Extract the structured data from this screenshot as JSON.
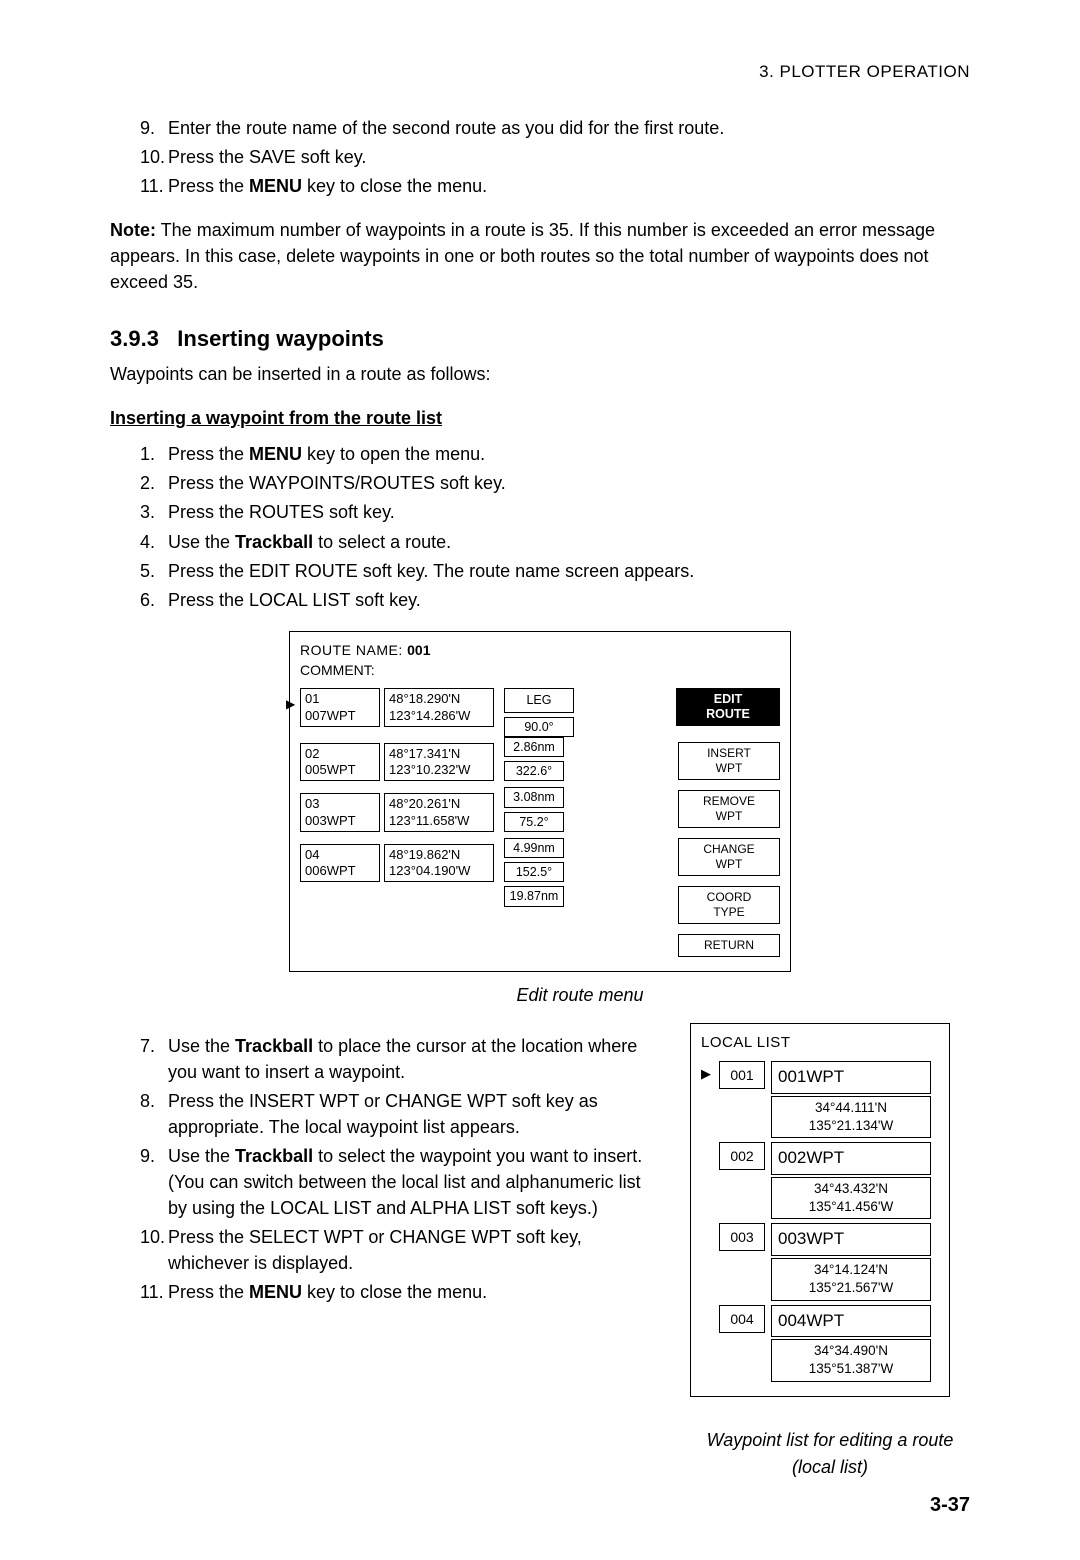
{
  "header": "3.  PLOTTER  OPERATION",
  "steps_top": [
    {
      "n": "9.",
      "t_pre": "Enter the route name of the second route as you did for the first route."
    },
    {
      "n": "10.",
      "t_pre": "Press the SAVE soft key."
    },
    {
      "n": "11.",
      "t_pre": "Press the ",
      "bold": "MENU",
      "t_post": " key to close the menu."
    }
  ],
  "note_label": "Note:",
  "note_text": " The maximum number of waypoints in a route is 35. If this number is exceeded an error message appears. In this case, delete waypoints in one or both routes so the total number of waypoints does not exceed 35.",
  "sec_num": "3.9.3",
  "sec_title": "Inserting waypoints",
  "sec_intro": "Waypoints can be inserted in a route as follows:",
  "sub1": "Inserting a waypoint from the route list",
  "steps1": [
    {
      "n": "1.",
      "pre": "Press the ",
      "b": "MENU",
      "post": " key to open the menu."
    },
    {
      "n": "2.",
      "pre": "Press the WAYPOINTS/ROUTES soft key."
    },
    {
      "n": "3.",
      "pre": "Press the ROUTES soft key."
    },
    {
      "n": "4.",
      "pre": "Use the ",
      "b": "Trackball",
      "post": " to select a route."
    },
    {
      "n": "5.",
      "pre": "Press the EDIT ROUTE soft key. The route name screen appears."
    },
    {
      "n": "6.",
      "pre": "Press the LOCAL LIST soft key."
    }
  ],
  "fig1": {
    "route_name_label": "ROUTE NAME: ",
    "route_name_value": "001",
    "comment_label": "COMMENT:",
    "leg_label": "LEG",
    "header_sk": "EDIT\nROUTE",
    "soft_keys": [
      "INSERT\nWPT",
      "REMOVE\nWPT",
      "CHANGE\nWPT",
      "COORD\nTYPE",
      "RETURN"
    ],
    "rows": [
      {
        "idx": "01",
        "name": "007WPT",
        "lat": "48°18.290'N",
        "lon": "123°14.286'W",
        "brg": "90.0°",
        "dist": "2.86nm"
      },
      {
        "idx": "02",
        "name": "005WPT",
        "lat": "48°17.341'N",
        "lon": "123°10.232'W",
        "brg": "322.6°",
        "dist": "3.08nm"
      },
      {
        "idx": "03",
        "name": "003WPT",
        "lat": "48°20.261'N",
        "lon": "123°11.658'W",
        "brg": "75.2°",
        "dist": "4.99nm"
      },
      {
        "idx": "04",
        "name": "006WPT",
        "lat": "48°19.862'N",
        "lon": "123°04.190'W",
        "brg": "152.5°",
        "dist": "19.87nm"
      }
    ],
    "caption": "Edit route menu"
  },
  "steps2": [
    {
      "n": "7.",
      "pre": "Use the ",
      "b": "Trackball",
      "post": " to place the cursor at the location where you want to insert a waypoint."
    },
    {
      "n": "8.",
      "pre": "Press the INSERT WPT or CHANGE WPT soft key as appropriate. The local waypoint list appears."
    },
    {
      "n": "9.",
      "pre": "Use the ",
      "b": "Trackball",
      "post": " to select the waypoint you want to insert. (You can switch between the local list and alphanumeric list by using the LOCAL LIST and ALPHA LIST soft keys.)"
    },
    {
      "n": "10.",
      "pre": "Press the SELECT WPT or CHANGE WPT soft key, whichever is displayed."
    },
    {
      "n": "11.",
      "pre": "Press the ",
      "b": "MENU",
      "post": " key to close the menu."
    }
  ],
  "fig2": {
    "title": "LOCAL LIST",
    "entries": [
      {
        "num": "001",
        "name": "001WPT",
        "lat": "34°44.111'N",
        "lon": "135°21.134'W"
      },
      {
        "num": "002",
        "name": "002WPT",
        "lat": "34°43.432'N",
        "lon": "135°41.456'W"
      },
      {
        "num": "003",
        "name": "003WPT",
        "lat": "34°14.124'N",
        "lon": "135°21.567'W"
      },
      {
        "num": "004",
        "name": "004WPT",
        "lat": "34°34.490'N",
        "lon": "135°51.387'W"
      }
    ],
    "caption": "Waypoint list for editing a route (local list)"
  },
  "page_number": "3-37"
}
